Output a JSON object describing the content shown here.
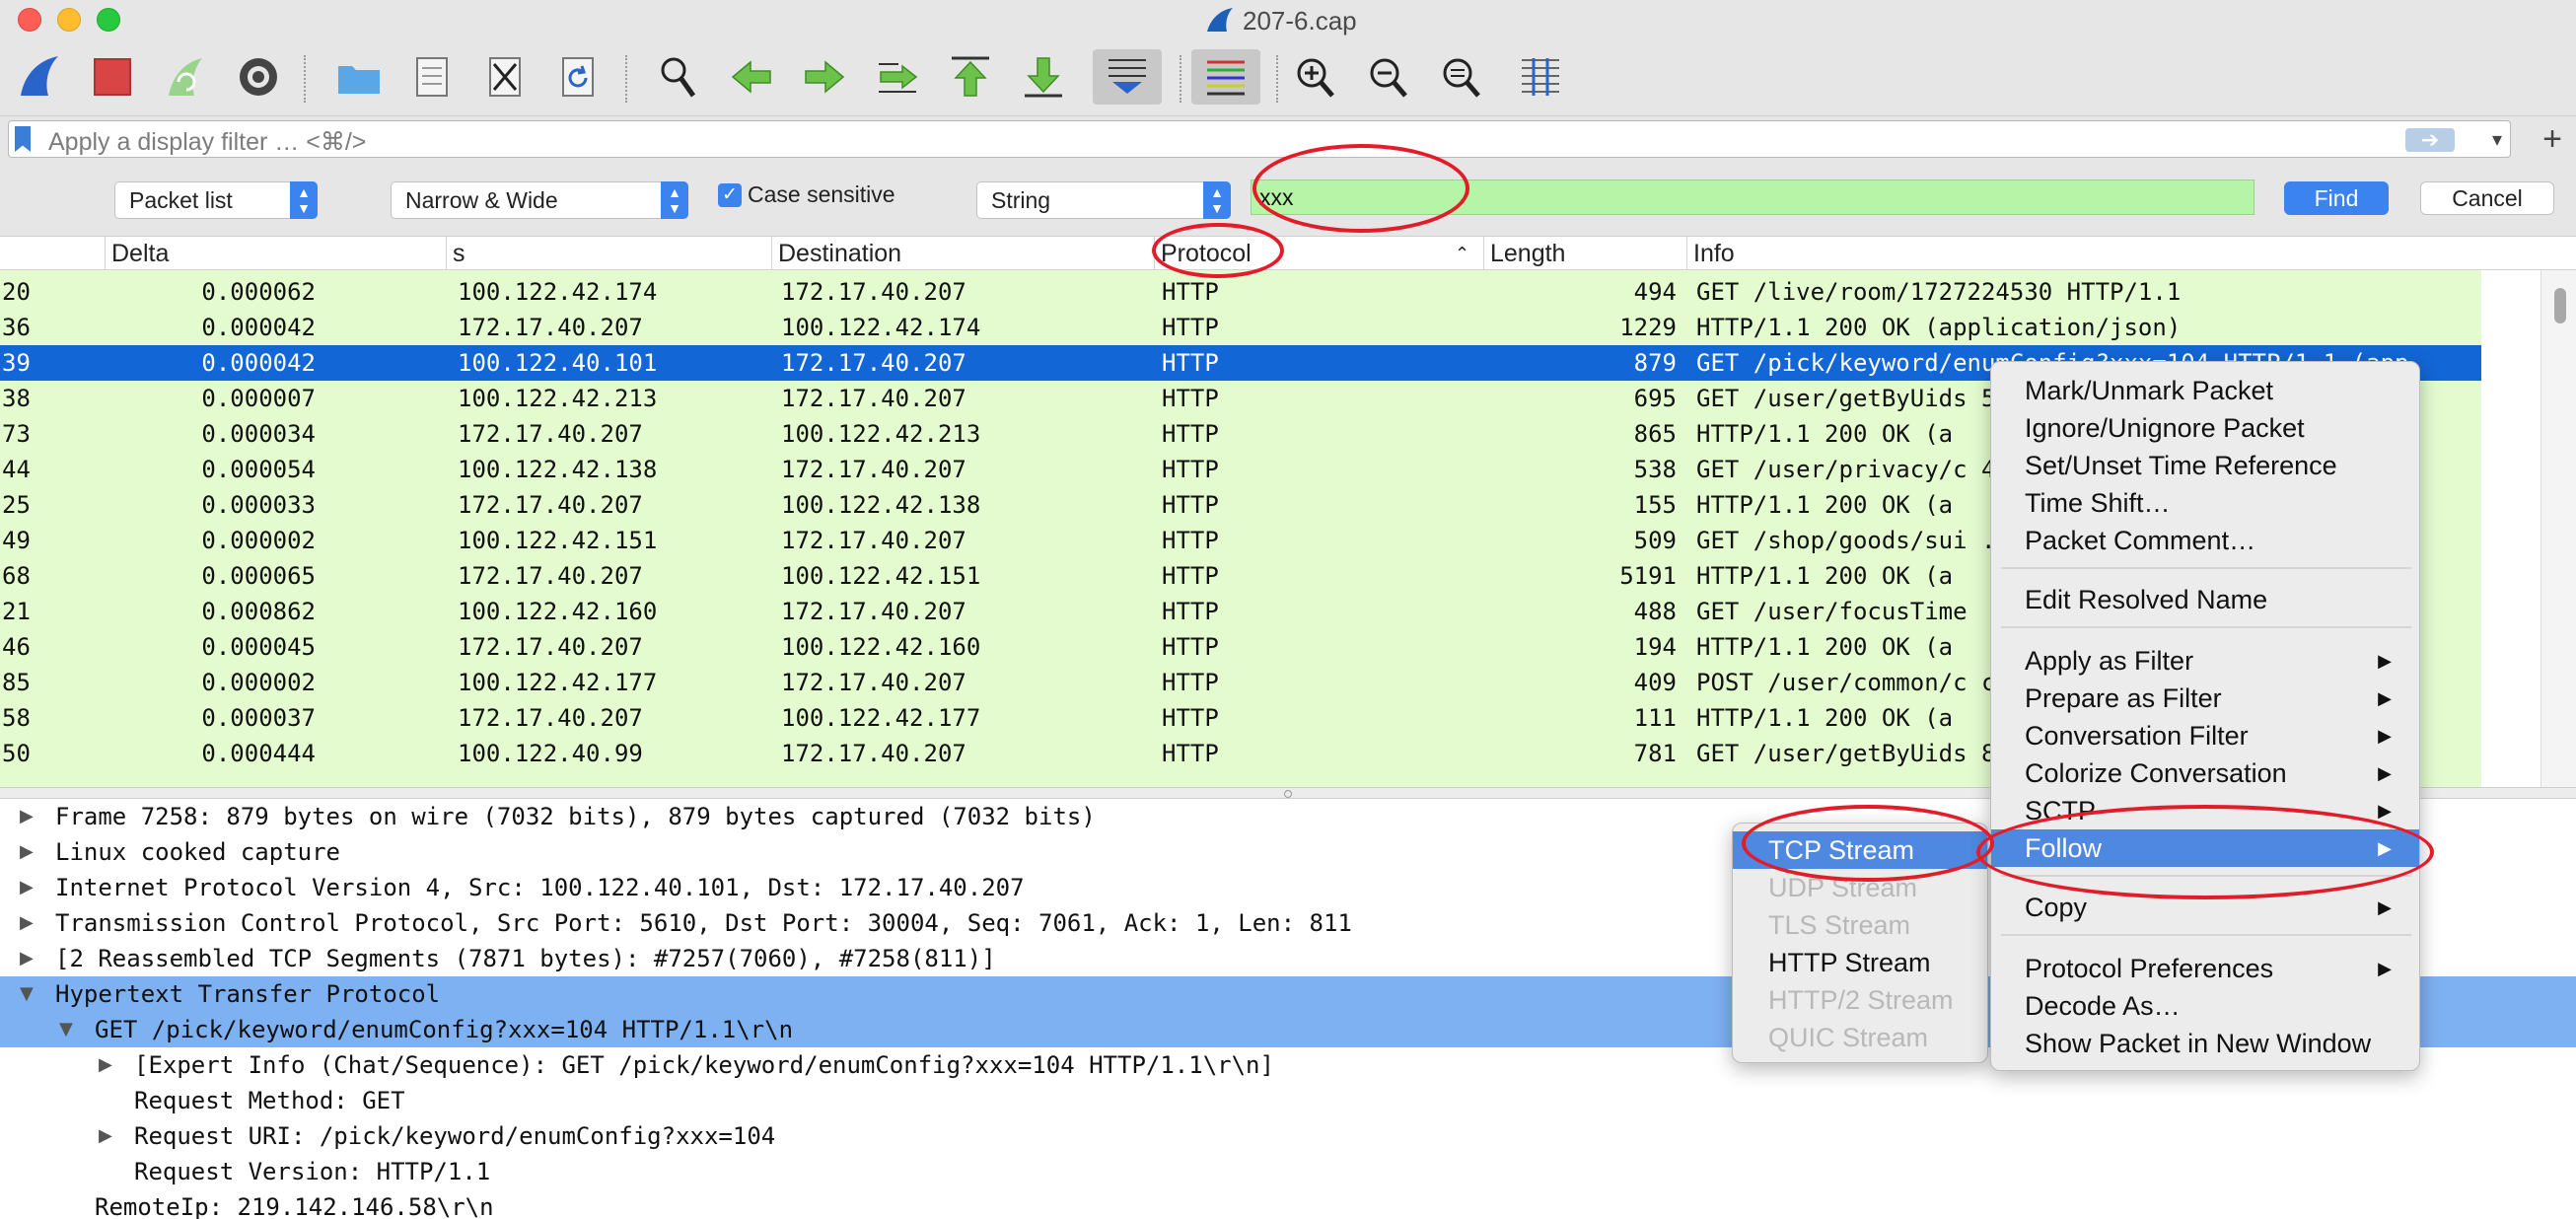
{
  "window": {
    "title": "207-6.cap"
  },
  "toolbar": {
    "icons": [
      "shark-fin-start-icon",
      "stop-capture-icon",
      "restart-capture-icon",
      "capture-options-icon",
      "open-file-icon",
      "save-file-icon",
      "close-file-icon",
      "reload-file-icon",
      "find-packet-icon",
      "go-back-icon",
      "go-forward-icon",
      "go-to-packet-icon",
      "first-packet-icon",
      "last-packet-icon",
      "auto-scroll-icon",
      "colorize-icon",
      "zoom-in-icon",
      "zoom-out-icon",
      "normal-size-icon",
      "resize-columns-icon"
    ]
  },
  "filter": {
    "placeholder": "Apply a display filter … <⌘/>"
  },
  "find": {
    "scope": "Packet list",
    "charset": "Narrow & Wide",
    "case_label": "Case sensitive",
    "type": "String",
    "value": "xxx",
    "find_label": "Find",
    "cancel_label": "Cancel"
  },
  "columns": [
    "Delta",
    "s",
    "Destination",
    "Protocol",
    "Length",
    "Info"
  ],
  "packets": [
    {
      "no": "20",
      "delta": "0.000062",
      "src": "100.122.42.174",
      "dst": "172.17.40.207",
      "proto": "HTTP",
      "len": "494",
      "info": "GET /live/room/1727224530 HTTP/1.1"
    },
    {
      "no": "36",
      "delta": "0.000042",
      "src": "172.17.40.207",
      "dst": "100.122.42.174",
      "proto": "HTTP",
      "len": "1229",
      "info": "HTTP/1.1 200 OK  (application/json)"
    },
    {
      "no": "39",
      "delta": "0.000042",
      "src": "100.122.40.101",
      "dst": "172.17.40.207",
      "proto": "HTTP",
      "len": "879",
      "info": "GET /pick/keyword/enumConfig?xxx=104 HTTP/1.1  (app"
    },
    {
      "no": "38",
      "delta": "0.000007",
      "src": "100.122.42.213",
      "dst": "172.17.40.207",
      "proto": "HTTP",
      "len": "695",
      "info": "GET /user/getByUids                             5892"
    },
    {
      "no": "73",
      "delta": "0.000034",
      "src": "172.17.40.207",
      "dst": "100.122.42.213",
      "proto": "HTTP",
      "len": "865",
      "info": "HTTP/1.1 200 OK  (a"
    },
    {
      "no": "44",
      "delta": "0.000054",
      "src": "100.122.42.138",
      "dst": "172.17.40.207",
      "proto": "HTTP",
      "len": "538",
      "info": "GET /user/privacy/c                             4779"
    },
    {
      "no": "25",
      "delta": "0.000033",
      "src": "172.17.40.207",
      "dst": "100.122.42.138",
      "proto": "HTTP",
      "len": "155",
      "info": "HTTP/1.1 200 OK  (a"
    },
    {
      "no": "49",
      "delta": "0.000002",
      "src": "100.122.42.151",
      "dst": "172.17.40.207",
      "proto": "HTTP",
      "len": "509",
      "info": "GET /shop/goods/sui                           .1"
    },
    {
      "no": "68",
      "delta": "0.000065",
      "src": "172.17.40.207",
      "dst": "100.122.42.151",
      "proto": "HTTP",
      "len": "5191",
      "info": "HTTP/1.1 200 OK  (a"
    },
    {
      "no": "21",
      "delta": "0.000862",
      "src": "100.122.42.160",
      "dst": "172.17.40.207",
      "proto": "HTTP",
      "len": "488",
      "info": "GET /user/focusTime"
    },
    {
      "no": "46",
      "delta": "0.000045",
      "src": "172.17.40.207",
      "dst": "100.122.42.160",
      "proto": "HTTP",
      "len": "194",
      "info": "HTTP/1.1 200 OK  (a"
    },
    {
      "no": "85",
      "delta": "0.000002",
      "src": "100.122.42.177",
      "dst": "172.17.40.207",
      "proto": "HTTP",
      "len": "409",
      "info": "POST /user/common/c                            cati"
    },
    {
      "no": "58",
      "delta": "0.000037",
      "src": "172.17.40.207",
      "dst": "100.122.42.177",
      "proto": "HTTP",
      "len": "111",
      "info": "HTTP/1.1 200 OK  (a"
    },
    {
      "no": "50",
      "delta": "0.000444",
      "src": "100.122.40.99",
      "dst": "172.17.40.207",
      "proto": "HTTP",
      "len": "781",
      "info": "GET /user/getByUids                            83393360892"
    }
  ],
  "details": [
    {
      "indent": 0,
      "tri": "▶",
      "text": "Frame 7258: 879 bytes on wire (7032 bits), 879 bytes captured (7032 bits)"
    },
    {
      "indent": 0,
      "tri": "▶",
      "text": "Linux cooked capture"
    },
    {
      "indent": 0,
      "tri": "▶",
      "text": "Internet Protocol Version 4, Src: 100.122.40.101, Dst: 172.17.40.207"
    },
    {
      "indent": 0,
      "tri": "▶",
      "text": "Transmission Control Protocol, Src Port: 5610, Dst Port: 30004, Seq: 7061, Ack: 1, Len: 811"
    },
    {
      "indent": 0,
      "tri": "▶",
      "text": "[2 Reassembled TCP Segments (7871 bytes): #7257(7060), #7258(811)]"
    },
    {
      "indent": 0,
      "tri": "▼",
      "text": "Hypertext Transfer Protocol"
    },
    {
      "indent": 1,
      "tri": "▼",
      "text": "GET /pick/keyword/enumConfig?xxx=104 HTTP/1.1\\r\\n"
    },
    {
      "indent": 2,
      "tri": "▶",
      "text": "[Expert Info (Chat/Sequence): GET /pick/keyword/enumConfig?xxx=104 HTTP/1.1\\r\\n]"
    },
    {
      "indent": 2,
      "tri": "",
      "text": "Request Method: GET"
    },
    {
      "indent": 2,
      "tri": "▶",
      "text": "Request URI: /pick/keyword/enumConfig?xxx=104"
    },
    {
      "indent": 2,
      "tri": "",
      "text": "Request Version: HTTP/1.1"
    },
    {
      "indent": 1,
      "tri": "",
      "text": "RemoteIp: 219.142.146.58\\r\\n"
    }
  ],
  "context_menu": {
    "group1": [
      "Mark/Unmark Packet",
      "Ignore/Unignore Packet",
      "Set/Unset Time Reference",
      "Time Shift…",
      "Packet Comment…"
    ],
    "group2": [
      "Edit Resolved Name"
    ],
    "group3": [
      "Apply as Filter",
      "Prepare as Filter",
      "Conversation Filter",
      "Colorize Conversation",
      "SCTP",
      "Follow"
    ],
    "group4": [
      "Copy"
    ],
    "group5": [
      "Protocol Preferences",
      "Decode As…",
      "Show Packet in New Window"
    ]
  },
  "follow_submenu": [
    "TCP Stream",
    "UDP Stream",
    "TLS Stream",
    "HTTP Stream",
    "HTTP/2 Stream",
    "QUIC Stream"
  ],
  "colors": {
    "accent": "#1366d6",
    "row_green": "#e4fbd0",
    "annotation": "#e31c2a",
    "find_green": "#b6f5a8"
  }
}
